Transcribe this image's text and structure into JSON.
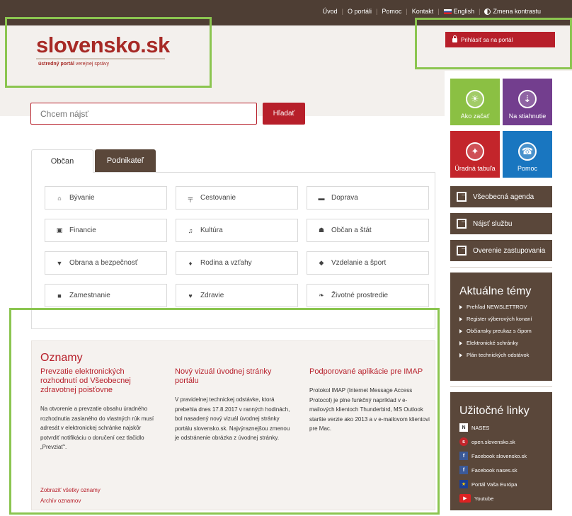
{
  "topnav": {
    "items": [
      "Úvod",
      "O portáli",
      "Pomoc",
      "Kontakt",
      "English",
      "Zmena kontrastu"
    ]
  },
  "header": {
    "logo": "slovensko.sk",
    "tagline_bold": "ústredný portál",
    "tagline_rest": "verejnej správy",
    "login_label": "Prihlásiť sa na portál"
  },
  "search": {
    "placeholder": "Chcem nájsť",
    "button": "Hľadať"
  },
  "tabs": [
    "Občan",
    "Podnikateľ"
  ],
  "categories": [
    {
      "label": "Bývanie",
      "icon": "home-icon"
    },
    {
      "label": "Cestovanie",
      "icon": "signpost-icon"
    },
    {
      "label": "Doprava",
      "icon": "car-icon"
    },
    {
      "label": "Financie",
      "icon": "money-icon"
    },
    {
      "label": "Kultúra",
      "icon": "music-icon"
    },
    {
      "label": "Občan a štát",
      "icon": "people-icon"
    },
    {
      "label": "Obrana a bezpečnosť",
      "icon": "shield-icon"
    },
    {
      "label": "Rodina a vzťahy",
      "icon": "person-icon"
    },
    {
      "label": "Vzdelanie a šport",
      "icon": "graduation-cap-icon"
    },
    {
      "label": "Zamestnanie",
      "icon": "briefcase-icon"
    },
    {
      "label": "Zdravie",
      "icon": "heartbeat-icon"
    },
    {
      "label": "Životné prostredie",
      "icon": "leaf-icon"
    }
  ],
  "news": {
    "title": "Oznamy",
    "items": [
      {
        "headline": "Prevzatie elektronických rozhodnutí od Všeobecnej zdravotnej poisťovne",
        "body": "Na otvorenie a prevzatie obsahu úradného rozhodnutia zaslaného do vlastných rúk musí adresát v elektronickej schránke najskôr potvrdiť notifikáciu o doručení cez tlačidlo „Prevziať“."
      },
      {
        "headline": "Nový vizuál úvodnej stránky portálu",
        "body": "V pravidelnej technickej odstávke, ktorá prebehla dnes 17.8.2017 v ranných hodinách, bol nasadený nový vizuál úvodnej stránky portálu slovensko.sk. Najvýraznejšou zmenou je odstránenie obrázka z úvodnej stránky."
      },
      {
        "headline": "Podporované aplikácie pre IMAP",
        "body": "Protokol IMAP (Internet Message Access Protocol) je plne funkčný napríklad v e-mailových klientoch Thunderbird, MS Outlook staršie verzie ako 2013 a v e-mailovom klientovi pre Mac."
      }
    ],
    "link_all": "Zobraziť všetky oznamy",
    "link_archive": "Archív oznamov"
  },
  "tiles": [
    {
      "label": "Ako začať",
      "icon": "lightbulb-icon",
      "color": "#8bc043"
    },
    {
      "label": "Na stiahnutie",
      "icon": "download-icon",
      "color": "#733e8e"
    },
    {
      "label": "Úradná tabuľa",
      "icon": "pin-icon",
      "color": "#c3252b"
    },
    {
      "label": "Pomoc",
      "icon": "phone-icon",
      "color": "#1976c0"
    }
  ],
  "side_buttons": [
    "Všeobecná agenda",
    "Nájsť službu",
    "Overenie zastupovania"
  ],
  "topics": {
    "title": "Aktuálne témy",
    "items": [
      "Prehľad NEWSLETTROV",
      "Register výberových konaní",
      "Občiansky preukaz s čipom",
      "Elektronické schránky",
      "Plán technických odstávok"
    ]
  },
  "links": {
    "title": "Užitočné linky",
    "items": [
      "NASES",
      "open.slovensko.sk",
      "Facebook slovensko.sk",
      "Facebook nases.sk",
      "Portál Vaša Európa",
      "Youtube"
    ]
  },
  "colors": {
    "brand_red": "#b71f2a",
    "brown": "#5a473a",
    "highlight_green": "#8bc550"
  }
}
